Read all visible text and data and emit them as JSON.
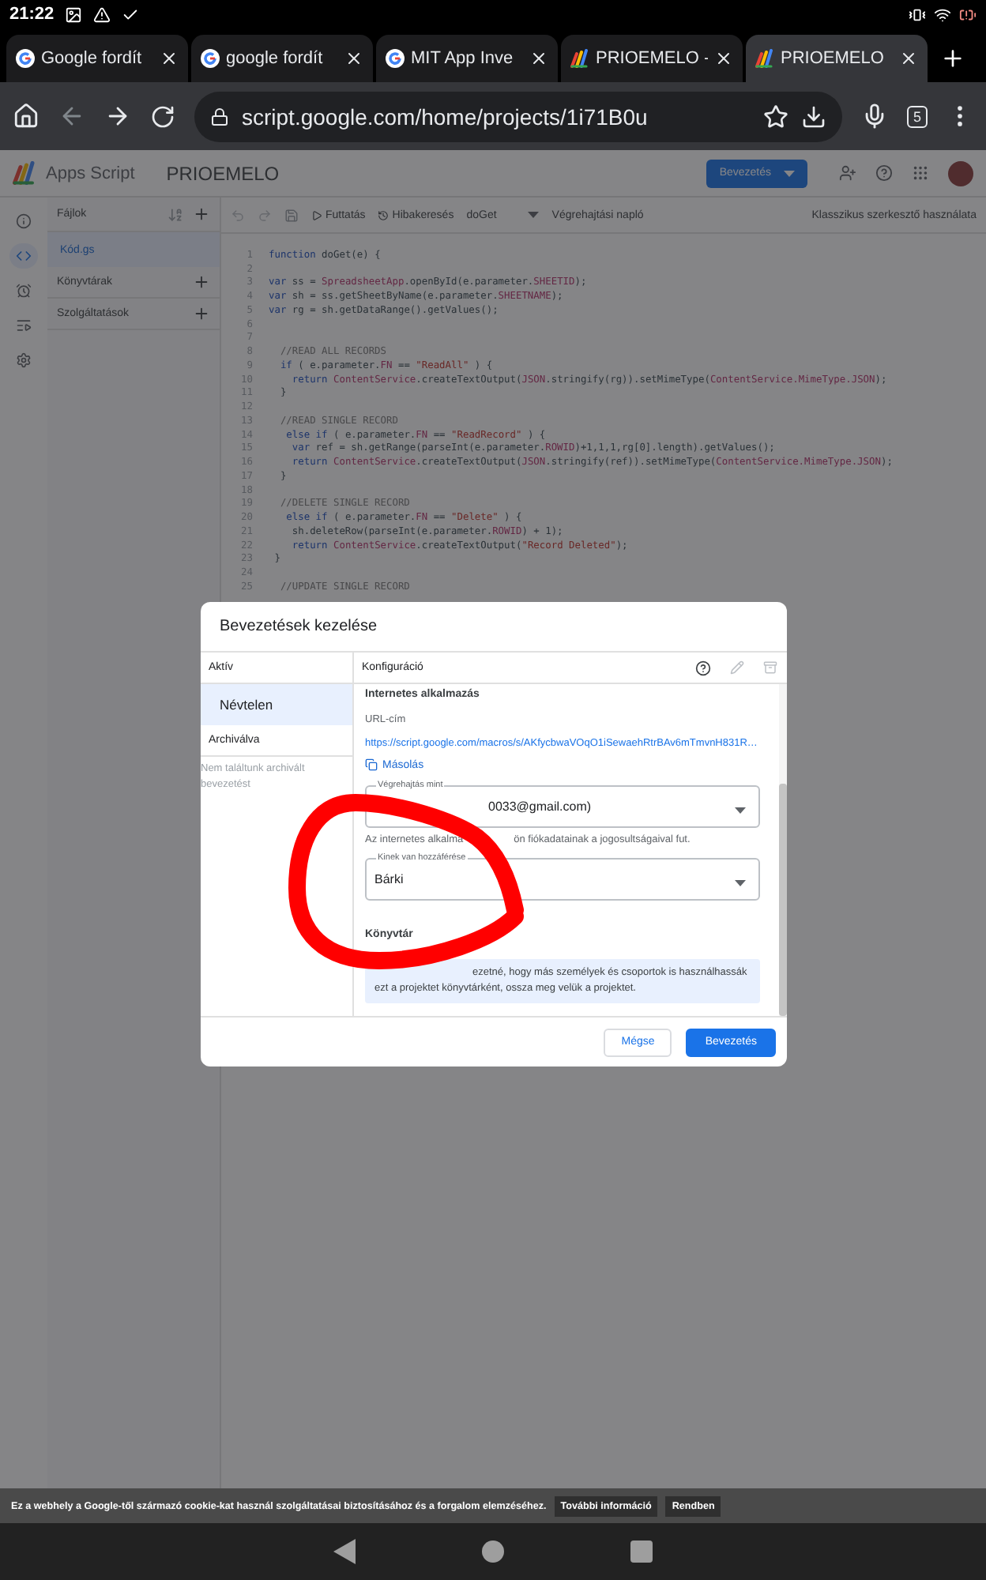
{
  "status_bar": {
    "time": "21:22"
  },
  "browser_tabs": [
    {
      "title": "Google fordít",
      "kind": "google",
      "selected": false
    },
    {
      "title": "google fordít",
      "kind": "google",
      "selected": false
    },
    {
      "title": "MIT App Inve",
      "kind": "google",
      "selected": false
    },
    {
      "title": "PRIOEMELO -",
      "kind": "apps-script",
      "selected": false
    },
    {
      "title": "PRIOEMELO",
      "kind": "apps-script",
      "selected": true
    }
  ],
  "address_bar": {
    "url": "script.google.com/home/projects/1i71B0u",
    "tab_count": "5"
  },
  "app_header": {
    "product": "Apps Script",
    "project": "PRIOEMELO",
    "deploy_button": "Bevezetés"
  },
  "left_rail": [
    {
      "kind": "info",
      "selected": false
    },
    {
      "kind": "code",
      "selected": true
    },
    {
      "kind": "triggers",
      "selected": false
    },
    {
      "kind": "executions",
      "selected": false
    },
    {
      "kind": "settings",
      "selected": false
    }
  ],
  "files_panel": {
    "title": "Fájlok",
    "files": [
      {
        "name": "Kód.gs",
        "selected": true
      }
    ],
    "sections": [
      "Könyvtárak",
      "Szolgáltatások"
    ]
  },
  "editor_toolbar": {
    "run": "Futtatás",
    "debug": "Hibakeresés",
    "function": "doGet",
    "log": "Végrehajtási napló",
    "classic": "Klasszikus szerkesztő használata"
  },
  "code_lines": [
    {
      "number": "1",
      "tokens": [
        {
          "kind": "kw",
          "text": "function"
        },
        {
          "kind": "pl",
          "text": " doGet(e) {"
        }
      ]
    },
    {
      "number": "2"
    },
    {
      "number": "3",
      "tokens": [
        {
          "kind": "kw",
          "text": "var"
        },
        {
          "kind": "pl",
          "text": " ss = "
        },
        {
          "kind": "cls",
          "text": "SpreadsheetApp"
        },
        {
          "kind": "pl",
          "text": ".openById(e.parameter."
        },
        {
          "kind": "cls",
          "text": "SHEETID"
        },
        {
          "kind": "pl",
          "text": ");"
        }
      ]
    },
    {
      "number": "4",
      "tokens": [
        {
          "kind": "kw",
          "text": "var"
        },
        {
          "kind": "pl",
          "text": " sh = ss.getSheetByName(e.parameter."
        },
        {
          "kind": "cls",
          "text": "SHEETNAME"
        },
        {
          "kind": "pl",
          "text": ");"
        }
      ]
    },
    {
      "number": "5",
      "tokens": [
        {
          "kind": "kw",
          "text": "var"
        },
        {
          "kind": "pl",
          "text": " rg = sh.getDataRange().getValues();"
        }
      ]
    },
    {
      "number": "6"
    },
    {
      "number": "7"
    },
    {
      "number": "8",
      "tokens": [
        {
          "kind": "cm",
          "text": "  //READ ALL RECORDS"
        }
      ]
    },
    {
      "number": "9",
      "tokens": [
        {
          "kind": "kw",
          "text": "  if"
        },
        {
          "kind": "pl",
          "text": " ( e.parameter."
        },
        {
          "kind": "cls",
          "text": "FN"
        },
        {
          "kind": "pl",
          "text": " == "
        },
        {
          "kind": "str",
          "text": "\"ReadAll\""
        },
        {
          "kind": "pl",
          "text": " ) {"
        }
      ]
    },
    {
      "number": "10",
      "tokens": [
        {
          "kind": "kw",
          "text": "    return"
        },
        {
          "kind": "cls",
          "text": " ContentService"
        },
        {
          "kind": "pl",
          "text": ".createTextOutput("
        },
        {
          "kind": "cls",
          "text": "JSON"
        },
        {
          "kind": "pl",
          "text": ".stringify(rg)).setMimeType("
        },
        {
          "kind": "cls",
          "text": "ContentService.MimeType.JSON"
        },
        {
          "kind": "pl",
          "text": ");"
        }
      ]
    },
    {
      "number": "11",
      "tokens": [
        {
          "kind": "pl",
          "text": "  }"
        }
      ]
    },
    {
      "number": "12"
    },
    {
      "number": "13",
      "tokens": [
        {
          "kind": "cm",
          "text": "  //READ SINGLE RECORD"
        }
      ]
    },
    {
      "number": "14",
      "tokens": [
        {
          "kind": "kw",
          "text": "   else if"
        },
        {
          "kind": "pl",
          "text": " ( e.parameter."
        },
        {
          "kind": "cls",
          "text": "FN"
        },
        {
          "kind": "pl",
          "text": " == "
        },
        {
          "kind": "str",
          "text": "\"ReadRecord\""
        },
        {
          "kind": "pl",
          "text": " ) {"
        }
      ]
    },
    {
      "number": "15",
      "tokens": [
        {
          "kind": "kw",
          "text": "    var"
        },
        {
          "kind": "pl",
          "text": " ref = sh.getRange(parseInt(e.parameter."
        },
        {
          "kind": "cls",
          "text": "ROWID"
        },
        {
          "kind": "pl",
          "text": ")+1,1,1,rg[0].length).getValues();"
        }
      ]
    },
    {
      "number": "16",
      "tokens": [
        {
          "kind": "kw",
          "text": "    return"
        },
        {
          "kind": "cls",
          "text": " ContentService"
        },
        {
          "kind": "pl",
          "text": ".createTextOutput("
        },
        {
          "kind": "cls",
          "text": "JSON"
        },
        {
          "kind": "pl",
          "text": ".stringify(ref)).setMimeType("
        },
        {
          "kind": "cls",
          "text": "ContentService.MimeType.JSON"
        },
        {
          "kind": "pl",
          "text": ");"
        }
      ]
    },
    {
      "number": "17",
      "tokens": [
        {
          "kind": "pl",
          "text": "  }"
        }
      ]
    },
    {
      "number": "18"
    },
    {
      "number": "19",
      "tokens": [
        {
          "kind": "cm",
          "text": "  //DELETE SINGLE RECORD"
        }
      ]
    },
    {
      "number": "20",
      "tokens": [
        {
          "kind": "kw",
          "text": "   else if"
        },
        {
          "kind": "pl",
          "text": " ( e.parameter."
        },
        {
          "kind": "cls",
          "text": "FN"
        },
        {
          "kind": "pl",
          "text": " == "
        },
        {
          "kind": "str",
          "text": "\"Delete\""
        },
        {
          "kind": "pl",
          "text": " ) {"
        }
      ]
    },
    {
      "number": "21",
      "tokens": [
        {
          "kind": "pl",
          "text": "    sh.deleteRow(parseInt(e.parameter."
        },
        {
          "kind": "cls",
          "text": "ROWID"
        },
        {
          "kind": "pl",
          "text": ") + 1);"
        }
      ]
    },
    {
      "number": "22",
      "tokens": [
        {
          "kind": "kw",
          "text": "    return"
        },
        {
          "kind": "cls",
          "text": " ContentService"
        },
        {
          "kind": "pl",
          "text": ".createTextOutput("
        },
        {
          "kind": "str",
          "text": "\"Record Deleted\""
        },
        {
          "kind": "pl",
          "text": ");"
        }
      ]
    },
    {
      "number": "23",
      "tokens": [
        {
          "kind": "pl",
          "text": " }"
        }
      ]
    },
    {
      "number": "24"
    },
    {
      "number": "25",
      "tokens": [
        {
          "kind": "cm",
          "text": "  //UPDATE SINGLE RECORD"
        }
      ]
    }
  ],
  "dialog": {
    "title": "Bevezetések kezelése",
    "active_header": "Aktív",
    "deployments": [
      {
        "name": "Névtelen",
        "selected": true
      }
    ],
    "archived_header": "Archiválva",
    "archived_empty": "Nem találtunk archivált bevezetést",
    "config_title": "Konfiguráció",
    "section_title": "Internetes alkalmazás",
    "url_label": "URL-cím",
    "url": "https://script.google.com/macros/s/AKfycbwaVOqO1iSewaehRtrBAv6mTmvnH831R…",
    "copy": "Másolás",
    "execute_as": {
      "label": "Végrehajtás mint",
      "value_end": "0033@gmail.com)"
    },
    "execute_hint": {
      "start": "Az internetes alkalma",
      "end": "ön fiókadatainak a jogosultságaival fut."
    },
    "access": {
      "label": "Kinek van hozzáférése",
      "value": "Bárki"
    },
    "library_title": "Könyvtár",
    "library_info": "ezetné, hogy más személyek és csoportok is használhassák ezt a projektet könyvtárként, ossza meg velük a projektet.",
    "buttons": [
      {
        "label": "Mégse",
        "kind": "secondary"
      },
      {
        "label": "Bevezetés",
        "kind": "primary"
      }
    ]
  },
  "cookie_bar": {
    "text": "Ez a webhely a Google-től származó cookie-kat használ szolgáltatásai biztosításához és a forgalom elemzéséhez.",
    "buttons": [
      "További információ",
      "Rendben"
    ]
  }
}
